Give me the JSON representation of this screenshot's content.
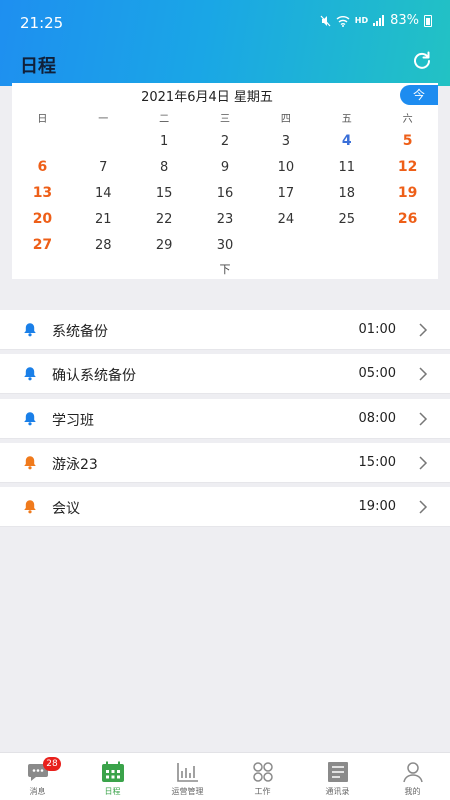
{
  "status_bar": {
    "time": "21:25",
    "battery": "83%",
    "network": "HD"
  },
  "header": {
    "title": "日程"
  },
  "calendar": {
    "title": "2021年6月4日 星期五",
    "today_label": "今",
    "weekdays": [
      "日",
      "一",
      "二",
      "三",
      "四",
      "五",
      "六"
    ],
    "weeks": [
      [
        "",
        "",
        "1",
        "2",
        "3",
        "4",
        "5"
      ],
      [
        "6",
        "7",
        "8",
        "9",
        "10",
        "11",
        "12"
      ],
      [
        "13",
        "14",
        "15",
        "16",
        "17",
        "18",
        "19"
      ],
      [
        "20",
        "21",
        "22",
        "23",
        "24",
        "25",
        "26"
      ],
      [
        "27",
        "28",
        "29",
        "30",
        "",
        "",
        ""
      ]
    ],
    "selected_day": "4",
    "expand_label": "下",
    "weekend_color": "#ee5f18",
    "today_color": "#3a6fd8"
  },
  "schedule": [
    {
      "title": "系统备份",
      "time": "01:00",
      "bell_color": "#1a7fe8"
    },
    {
      "title": "确认系统备份",
      "time": "05:00",
      "bell_color": "#1a7fe8"
    },
    {
      "title": "学习班",
      "time": "08:00",
      "bell_color": "#1a7fe8"
    },
    {
      "title": "游泳23",
      "time": "15:00",
      "bell_color": "#f07a1c"
    },
    {
      "title": "会议",
      "time": "19:00",
      "bell_color": "#f07a1c"
    }
  ],
  "tabbar": {
    "items": [
      {
        "label": "消息",
        "icon": "message-icon",
        "badge": "28"
      },
      {
        "label": "日程",
        "icon": "calendar-icon",
        "active": true
      },
      {
        "label": "运营管理",
        "icon": "chart-icon"
      },
      {
        "label": "工作",
        "icon": "grid-icon"
      },
      {
        "label": "通讯录",
        "icon": "contacts-icon"
      },
      {
        "label": "我的",
        "icon": "person-icon"
      }
    ],
    "active_color": "#3aa34a"
  }
}
